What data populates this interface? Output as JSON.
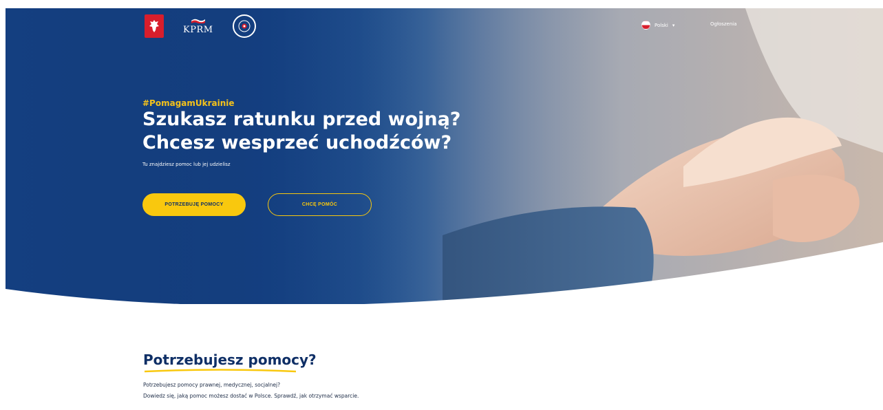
{
  "header": {
    "logos": {
      "emblem_icon": "polish-eagle-icon",
      "kprm_label": "KPRM",
      "seal_icon": "government-seal-icon"
    },
    "language": {
      "current": "Polski",
      "flag_icon": "poland-flag-icon",
      "chevron_icon": "chevron-down-icon"
    },
    "announcements_label": "Ogłoszenia"
  },
  "hero": {
    "hashtag": "#PomagamUkrainie",
    "title_line1": "Szukasz ratunku przed wojną?",
    "title_line2": "Chcesz wesprzeć uchodźców?",
    "subtitle": "Tu znajdziesz pomoc lub jej udzielisz",
    "primary_button": "POTRZEBUJĘ POMOCY",
    "secondary_button": "CHCĘ POMÓC"
  },
  "section": {
    "title": "Potrzebujesz pomocy?",
    "line1": "Potrzebujesz pomocy prawnej, medycznej, socjalnej?",
    "line2": "Dowiedz się, jaką pomoc możesz dostać w Polsce. Sprawdź, jak otrzymać wsparcie."
  },
  "colors": {
    "navy": "#143f80",
    "accent_yellow": "#f9c80e",
    "hashtag_yellow": "#f4c21b",
    "title_dark": "#0f2f66"
  }
}
